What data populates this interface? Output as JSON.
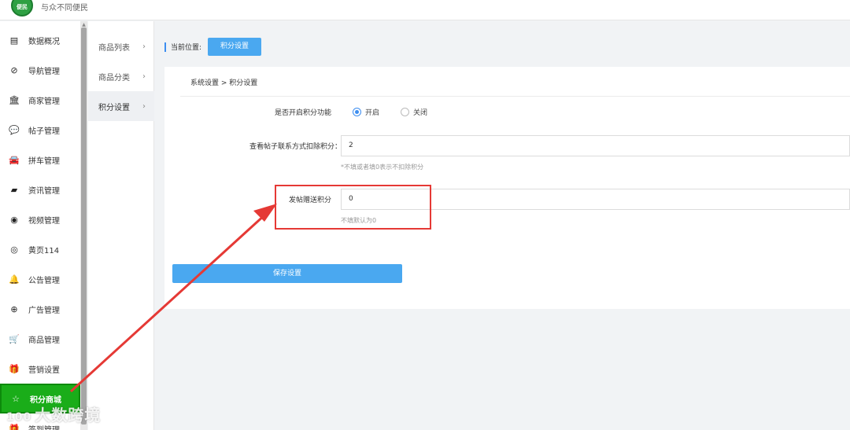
{
  "header": {
    "logo_text": "便民",
    "slogan": "与众不同便民"
  },
  "sidebar": {
    "items": [
      {
        "icon": "chart-card-icon",
        "glyph": "▤",
        "label": "数据概况"
      },
      {
        "icon": "compass-icon",
        "glyph": "⊘",
        "label": "导航管理"
      },
      {
        "icon": "bank-icon",
        "glyph": "🏛",
        "label": "商家管理"
      },
      {
        "icon": "comment-icon",
        "glyph": "💬",
        "label": "帖子管理"
      },
      {
        "icon": "car-icon",
        "glyph": "🚘",
        "label": "拼车管理"
      },
      {
        "icon": "book-icon",
        "glyph": "▰",
        "label": "资讯管理"
      },
      {
        "icon": "video-icon",
        "glyph": "◉",
        "label": "视频管理"
      },
      {
        "icon": "yellowpage-icon",
        "glyph": "◎",
        "label": "黄页114"
      },
      {
        "icon": "bell-icon",
        "glyph": "🔔",
        "label": "公告管理"
      },
      {
        "icon": "lifebuoy-icon",
        "glyph": "⊕",
        "label": "广告管理"
      },
      {
        "icon": "cart-icon",
        "glyph": "🛒",
        "label": "商品管理"
      },
      {
        "icon": "gift-icon",
        "glyph": "🎁",
        "label": "营销设置"
      },
      {
        "icon": "star-icon",
        "glyph": "☆",
        "label": "积分商城"
      },
      {
        "icon": "gift-icon-2",
        "glyph": "🎁",
        "label": "签到管理"
      }
    ]
  },
  "submenu": {
    "items": [
      {
        "label": "商品列表",
        "chevron": "›"
      },
      {
        "label": "商品分类",
        "chevron": "›"
      },
      {
        "label": "积分设置",
        "chevron": "›"
      }
    ]
  },
  "breadcrumb": {
    "label": "当前位置:",
    "current": "积分设置"
  },
  "panel": {
    "path": "系统设置 > 积分设置",
    "enable_label": "是否开启积分功能",
    "radio_on": "开启",
    "radio_off": "关闭",
    "contact_label": "查看帖子联系方式扣除积分：",
    "contact_value": "2",
    "contact_hint": "*不填或者填0表示不扣除积分",
    "post_label": "发帖赠送积分",
    "post_value": "0",
    "post_hint": "不填默认为0",
    "save_label": "保存设置"
  },
  "watermark": {
    "logo": "100",
    "text": "大数跨境"
  },
  "colors": {
    "accent_blue": "#4aa8f0",
    "active_green": "#1aad19",
    "annotation_red": "#e53935"
  }
}
